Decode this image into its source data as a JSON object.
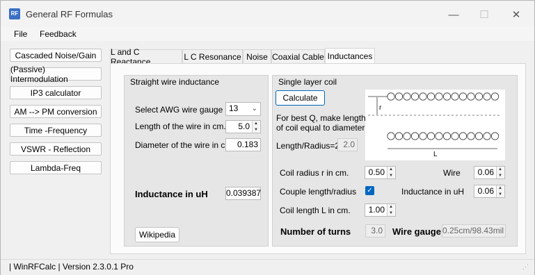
{
  "window": {
    "icon_text": "RF",
    "title": "General RF Formulas",
    "minimize": "—",
    "maximize": "☐",
    "close": "✕"
  },
  "menu": {
    "file": "File",
    "feedback": "Feedback"
  },
  "side_buttons": [
    "Cascaded Noise/Gain",
    "(Passive) Intermodulation",
    "IP3 calculator",
    "AM --> PM conversion",
    "Time -Frequency",
    "VSWR - Reflection",
    "Lambda-Freq"
  ],
  "tabs": [
    "L and C Reactance",
    "L C Resonance",
    "Noise",
    "Coaxial Cable",
    "Inductances"
  ],
  "active_tab": "Inductances",
  "straight": {
    "title": "Straight wire inductance",
    "awg_label": "Select AWG wire gauge",
    "awg_value": "13",
    "length_label": "Length of the wire in cm.",
    "length_value": "5.0",
    "diameter_label": "Diameter of the wire in cm.",
    "diameter_value": "0.183",
    "inductance_label": "Inductance in uH",
    "inductance_value": "0.039387",
    "wikipedia_button": "Wikipedia"
  },
  "coil": {
    "title": "Single layer coil",
    "calculate_button": "Calculate",
    "note_line1": "For best Q, make length",
    "note_line2": "of coil equal to diameter",
    "ratio_label": "Length/Radius=2",
    "ratio_value": "2.0",
    "diagram_r": "r",
    "diagram_l": "L",
    "radius_label": "Coil radius r in cm.",
    "radius_value": "0.50",
    "wire_label": "Wire",
    "wire_value": "0.06",
    "couple_label": "Couple length/radius",
    "couple_checked": true,
    "inductance_label": "Inductance in uH",
    "inductance_value": "0.06",
    "length_label": "Coil length L in cm.",
    "length_value": "1.00",
    "turns_label": "Number of turns",
    "turns_value": "3.0",
    "gauge_label": "Wire gauge",
    "gauge_value": "0.25cm/98.43mil"
  },
  "status": {
    "text": "| WinRFCalc | Version 2.3.0.1 Pro"
  },
  "colors": {
    "accent": "#0067c0",
    "group_bg": "#e6e6e6"
  }
}
